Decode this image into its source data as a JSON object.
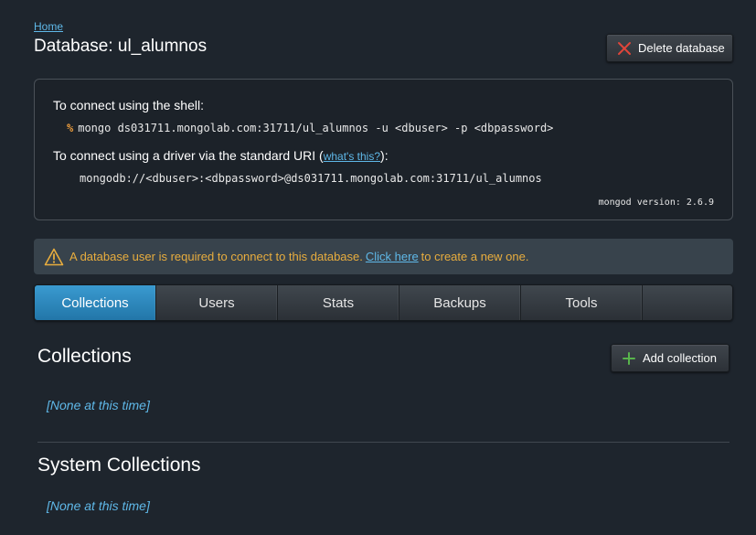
{
  "breadcrumb": {
    "home": "Home"
  },
  "page": {
    "title": "Database: ul_alumnos"
  },
  "actions": {
    "delete_database": "Delete database",
    "add_collection": "Add collection"
  },
  "connection": {
    "shell_label": "To connect using the shell:",
    "shell_prompt": "%",
    "shell_command": "mongo ds031711.mongolab.com:31711/ul_alumnos -u <dbuser> -p <dbpassword>",
    "driver_label_prefix": "To connect using a driver via the standard URI (",
    "driver_link": "what's this?",
    "driver_label_suffix": "):",
    "uri": "mongodb://<dbuser>:<dbpassword>@ds031711.mongolab.com:31711/ul_alumnos",
    "mongod_version": "mongod version: 2.6.9"
  },
  "warning": {
    "text_before": "A database user is required to connect to this database.",
    "link": "Click here",
    "text_after": "to create a new one."
  },
  "tabs": [
    {
      "label": "Collections",
      "active": true
    },
    {
      "label": "Users",
      "active": false
    },
    {
      "label": "Stats",
      "active": false
    },
    {
      "label": "Backups",
      "active": false
    },
    {
      "label": "Tools",
      "active": false
    }
  ],
  "sections": {
    "collections": {
      "title": "Collections",
      "empty": "[None at this time]"
    },
    "system_collections": {
      "title": "System Collections",
      "empty": "[None at this time]"
    }
  },
  "icons": {
    "delete": "close-x-icon",
    "add": "plus-icon",
    "warning": "warning-triangle-icon"
  },
  "colors": {
    "accent": "#2a86bd",
    "link": "#5fb8e8",
    "warning": "#e8ad3e",
    "prompt": "#e89a3c",
    "delete_icon": "#e0453a",
    "add_icon": "#58b44c"
  }
}
